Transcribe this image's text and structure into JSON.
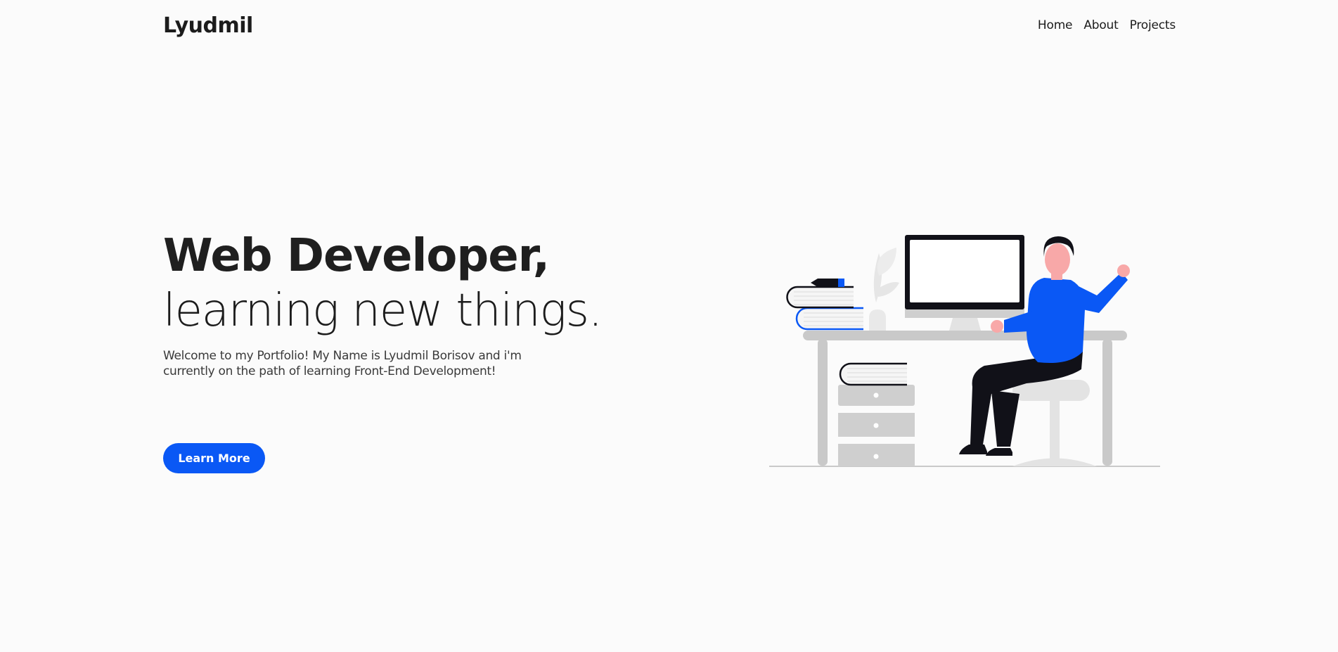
{
  "header": {
    "logo": "Lyudmil",
    "nav": [
      {
        "label": "Home"
      },
      {
        "label": "About"
      },
      {
        "label": "Projects"
      }
    ]
  },
  "hero": {
    "headline_strong": "Web Developer",
    "headline_comma": ",",
    "headline_line2": "learning new things.",
    "intro": "Welcome to my Portfolio! My Name is Lyudmil Borisov and i'm currently on the path of learning Front-End Development!",
    "cta_label": "Learn More"
  },
  "colors": {
    "accent": "#0a58f5",
    "text": "#1f1f1f",
    "background": "#fbfbfb"
  },
  "illustration": {
    "name": "developer-at-desk-illustration"
  }
}
